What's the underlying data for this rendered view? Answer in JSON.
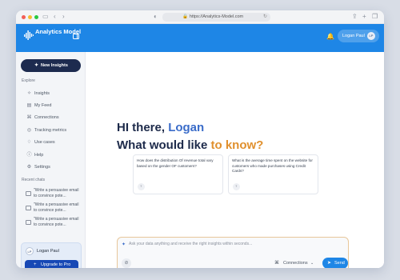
{
  "browser": {
    "url": "https://Analytics-Model.com"
  },
  "header": {
    "app_name": "Analytics Model",
    "user_name": "Logan Paul",
    "user_initials": "LP",
    "accent": "#1e86e6"
  },
  "sidebar": {
    "new_button": "New Insights",
    "explore_label": "Explore",
    "items": [
      {
        "label": "Insights",
        "icon": "sparkle-icon"
      },
      {
        "label": "My Feed",
        "icon": "feed-icon"
      },
      {
        "label": "Connections",
        "icon": "connections-icon"
      },
      {
        "label": "Tracking metrics",
        "icon": "tracking-icon"
      },
      {
        "label": "Use cases",
        "icon": "lightbulb-icon"
      },
      {
        "label": "Help",
        "icon": "help-icon"
      },
      {
        "label": "Settings",
        "icon": "gear-icon"
      }
    ],
    "recent_label": "Recent chats",
    "recent_chats": [
      "\"Write a persuasive email to convince pote...",
      "\"Write a persuasive email to convince pote...",
      "\"Write a persuasive email to convince pote..."
    ],
    "user_card": {
      "initials": "LP",
      "name": "Logan Paul",
      "upgrade_label": "Upgrade to Pro"
    }
  },
  "main": {
    "greeting_prefix": "HI there,",
    "greeting_name": "Logan",
    "question_prefix": "What would like",
    "question_highlight": "to know?",
    "suggestions": [
      "How does the distribution Of revenue total vary based on the gender OF customers?",
      "What is the average time spent on the website for customers who made purchases using Credit Cards?"
    ],
    "input_placeholder": "Ask your data anything and receive the right insights within seconds...",
    "connections_label": "Connections",
    "send_label": "Send"
  }
}
